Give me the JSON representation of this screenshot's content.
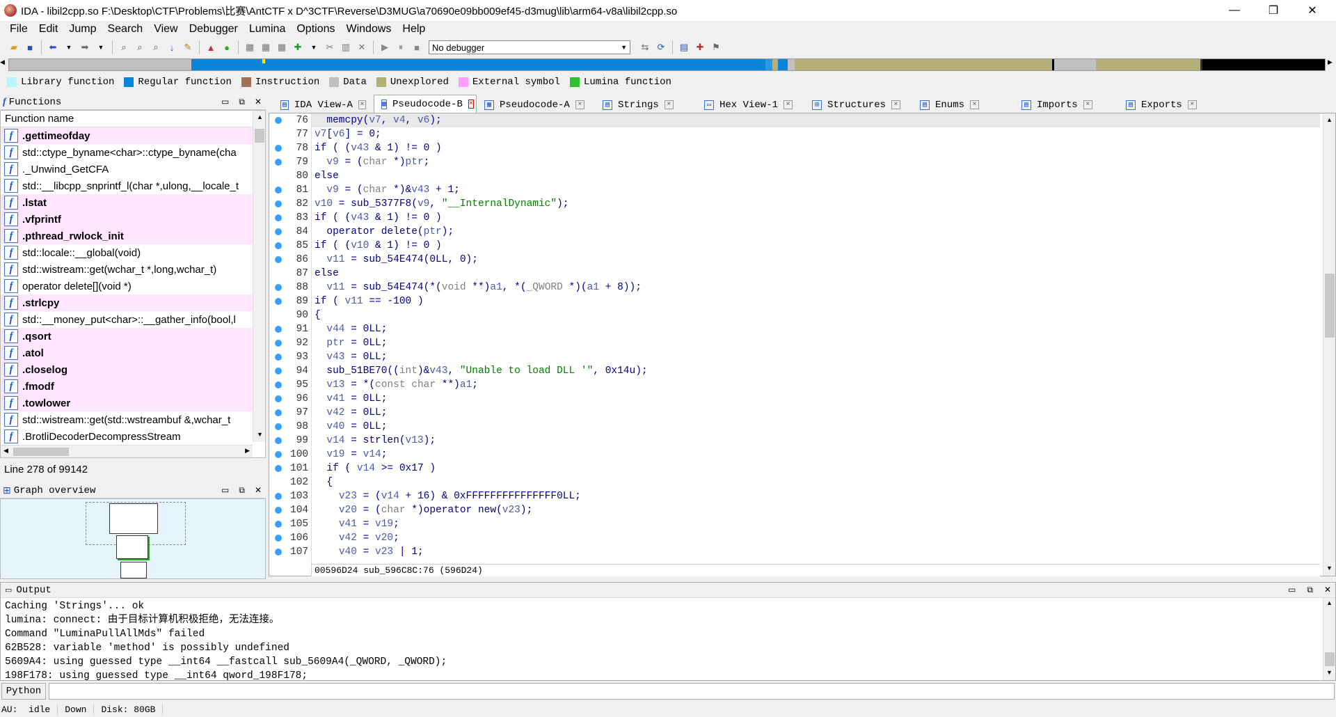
{
  "window": {
    "title": "IDA - libil2cpp.so F:\\Desktop\\CTF\\Problems\\比赛\\AntCTF x D^3CTF\\Reverse\\D3MUG\\a70690e09bb009ef45-d3mug\\lib\\arm64-v8a\\libil2cpp.so",
    "minimize": "—",
    "maximize": "❐",
    "close": "✕"
  },
  "menu": [
    "File",
    "Edit",
    "Jump",
    "Search",
    "View",
    "Debugger",
    "Lumina",
    "Options",
    "Windows",
    "Help"
  ],
  "toolbar": {
    "debugger": "No debugger"
  },
  "legend": [
    {
      "label": "Library function",
      "color": "#b9f3ff"
    },
    {
      "label": "Regular function",
      "color": "#0a84d8"
    },
    {
      "label": "Instruction",
      "color": "#a0705a"
    },
    {
      "label": "Data",
      "color": "#c0c0c0"
    },
    {
      "label": "Unexplored",
      "color": "#b5b07a"
    },
    {
      "label": "External symbol",
      "color": "#ff9eff"
    },
    {
      "label": "Lumina function",
      "color": "#2ec02e"
    }
  ],
  "functions_panel": {
    "title": "Functions",
    "column": "Function name",
    "status": "Line 278 of 99142",
    "rows": [
      {
        "name": ".gettimeofday",
        "lib": true
      },
      {
        "name": "std::ctype_byname<char>::ctype_byname(cha",
        "lib": false
      },
      {
        "name": "._Unwind_GetCFA",
        "lib": false
      },
      {
        "name": "std::__libcpp_snprintf_l(char *,ulong,__locale_t",
        "lib": false
      },
      {
        "name": ".lstat",
        "lib": true
      },
      {
        "name": ".vfprintf",
        "lib": true
      },
      {
        "name": ".pthread_rwlock_init",
        "lib": true
      },
      {
        "name": "std::locale::__global(void)",
        "lib": false
      },
      {
        "name": "std::wistream::get(wchar_t *,long,wchar_t)",
        "lib": false
      },
      {
        "name": "operator delete[](void *)",
        "lib": false
      },
      {
        "name": ".strlcpy",
        "lib": true
      },
      {
        "name": "std::__money_put<char>::__gather_info(bool,l",
        "lib": false
      },
      {
        "name": ".qsort",
        "lib": true
      },
      {
        "name": ".atol",
        "lib": true
      },
      {
        "name": ".closelog",
        "lib": true
      },
      {
        "name": ".fmodf",
        "lib": true
      },
      {
        "name": ".towlower",
        "lib": true
      },
      {
        "name": "std::wistream::get(std::wstreambuf &,wchar_t",
        "lib": false
      },
      {
        "name": ".BrotliDecoderDecompressStream",
        "lib": false
      }
    ]
  },
  "graph_panel": {
    "title": "Graph overview"
  },
  "tabs": [
    {
      "label": "IDA View-A",
      "active": false
    },
    {
      "label": "Pseudocode-B",
      "active": true
    },
    {
      "label": "Pseudocode-A",
      "active": false
    },
    {
      "label": "Strings",
      "active": false
    },
    {
      "label": "Hex View-1",
      "active": false
    },
    {
      "label": "Structures",
      "active": false
    },
    {
      "label": "Enums",
      "active": false
    },
    {
      "label": "Imports",
      "active": false
    },
    {
      "label": "Exports",
      "active": false
    }
  ],
  "code": {
    "line_numbers": [
      "76",
      "77",
      "78",
      "79",
      "80",
      "81",
      "82",
      "83",
      "84",
      "85",
      "86",
      "87",
      "88",
      "89",
      "90",
      "91",
      "92",
      "93",
      "94",
      "95",
      "96",
      "97",
      "98",
      "99",
      "100",
      "101",
      "102",
      "103",
      "104",
      "105",
      "106",
      "107"
    ],
    "dots": [
      true,
      false,
      true,
      true,
      false,
      true,
      true,
      true,
      true,
      true,
      true,
      false,
      true,
      true,
      false,
      true,
      true,
      true,
      true,
      true,
      true,
      true,
      true,
      true,
      true,
      true,
      false,
      true,
      true,
      true,
      true,
      true
    ],
    "lines": [
      "  memcpy(v7, v4, v6);",
      "v7[v6] = 0;",
      "if ( (v43 & 1) != 0 )",
      "  v9 = (char *)ptr;",
      "else",
      "  v9 = (char *)&v43 + 1;",
      "v10 = sub_5377F8(v9, \"__InternalDynamic\");",
      "if ( (v43 & 1) != 0 )",
      "  operator delete(ptr);",
      "if ( (v10 & 1) != 0 )",
      "  v11 = sub_54E474(0LL, 0);",
      "else",
      "  v11 = sub_54E474(*(void **)a1, *(_QWORD *)(a1 + 8));",
      "if ( v11 == -100 )",
      "{",
      "  v44 = 0LL;",
      "  ptr = 0LL;",
      "  v43 = 0LL;",
      "  sub_51BE70((int)&v43, \"Unable to load DLL '\", 0x14u);",
      "  v13 = *(const char **)a1;",
      "  v41 = 0LL;",
      "  v42 = 0LL;",
      "  v40 = 0LL;",
      "  v14 = strlen(v13);",
      "  v19 = v14;",
      "  if ( v14 >= 0x17 )",
      "  {",
      "    v23 = (v14 + 16) & 0xFFFFFFFFFFFFFFF0LL;",
      "    v20 = (char *)operator new(v23);",
      "    v41 = v19;",
      "    v42 = v20;",
      "    v40 = v23 | 1;"
    ],
    "status": "00596D24 sub_596C8C:76 (596D24)"
  },
  "output": {
    "title": "Output",
    "lines": [
      "Caching 'Strings'... ok",
      "lumina: connect: 由于目标计算机积极拒绝，无法连接。",
      "Command \"LuminaPullAllMds\" failed",
      "62B528: variable 'method' is possibly undefined",
      "5609A4: using guessed type __int64 __fastcall sub_5609A4(_QWORD, _QWORD);",
      "198F178: using guessed type __int64 qword_198F178;"
    ]
  },
  "python_button": "Python",
  "statusbar": {
    "au": "AU:",
    "state": "idle",
    "dir": "Down",
    "disk": "Disk: 80GB"
  }
}
